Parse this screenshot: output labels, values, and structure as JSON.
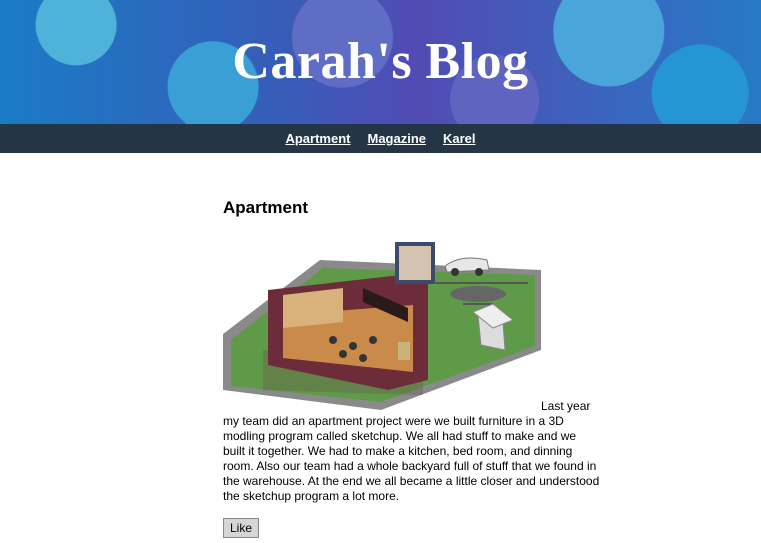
{
  "header": {
    "title": "Carah's Blog"
  },
  "nav": {
    "items": [
      "Apartment",
      "Magazine",
      "Karel"
    ]
  },
  "post": {
    "title": "Apartment",
    "body": "Last year my team did an apartment project were we built furniture in a 3D modling program called sketchup. We all had stuff to make and we built it together. We had to make a kitchen, bed room, and dinning room. Also our team had a whole backyard full of stuff that we found in the warehouse. At the end we all became a little closer and understood the sketchup program a lot more.",
    "like_label": "Like"
  }
}
